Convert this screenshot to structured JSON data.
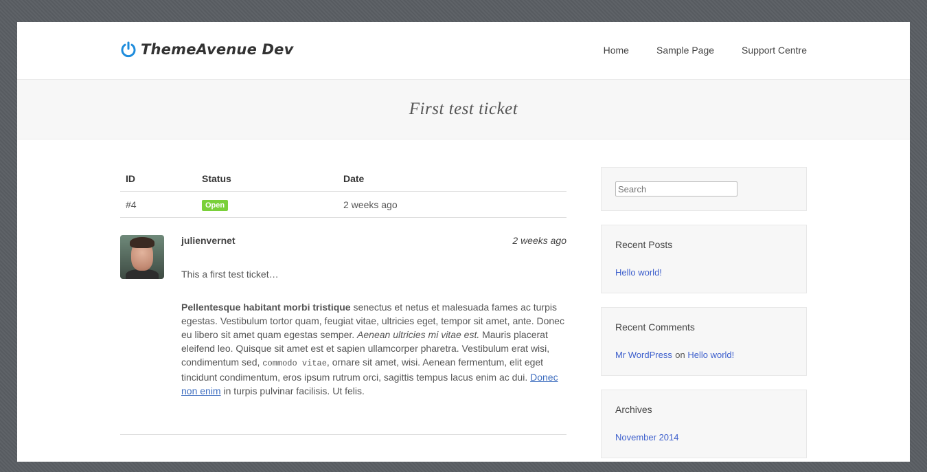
{
  "site": {
    "title": "ThemeAvenue Dev",
    "logo_icon": "power-icon",
    "accent_color": "#1e8cdc"
  },
  "nav": [
    {
      "label": "Home"
    },
    {
      "label": "Sample Page"
    },
    {
      "label": "Support Centre"
    }
  ],
  "page_title": "First test ticket",
  "ticket": {
    "headers": {
      "id": "ID",
      "status": "Status",
      "date": "Date"
    },
    "row": {
      "id": "#4",
      "status": "Open",
      "date": "2 weeks ago"
    },
    "status_color": "#7ad03a"
  },
  "reply": {
    "author": "julienvernet",
    "date": "2 weeks ago",
    "intro": "This a first test ticket…",
    "p_bold": "Pellentesque habitant morbi tristique",
    "p_part1": " senectus et netus et malesuada fames ac turpis egestas. Vestibulum tortor quam, feugiat vitae, ultricies eget, tempor sit amet, ante. Donec eu libero sit amet quam egestas semper. ",
    "p_italic": "Aenean ultricies mi vitae est.",
    "p_part2": " Mauris placerat eleifend leo. Quisque sit amet est et sapien ullamcorper pharetra. Vestibulum erat wisi, condimentum sed, ",
    "p_code": "commodo vitae",
    "p_part3": ", ornare sit amet, wisi. Aenean fermentum, elit eget tincidunt condimentum, eros ipsum rutrum orci, sagittis tempus lacus enim ac dui. ",
    "p_link": "Donec non enim",
    "p_part4": " in turpis pulvinar facilisis. Ut felis."
  },
  "sidebar": {
    "search_placeholder": "Search",
    "recent_posts": {
      "title": "Recent Posts",
      "items": [
        "Hello world!"
      ]
    },
    "recent_comments": {
      "title": "Recent Comments",
      "author": "Mr WordPress",
      "on": "on",
      "post": "Hello world!"
    },
    "archives": {
      "title": "Archives",
      "items": [
        "November 2014"
      ]
    }
  }
}
